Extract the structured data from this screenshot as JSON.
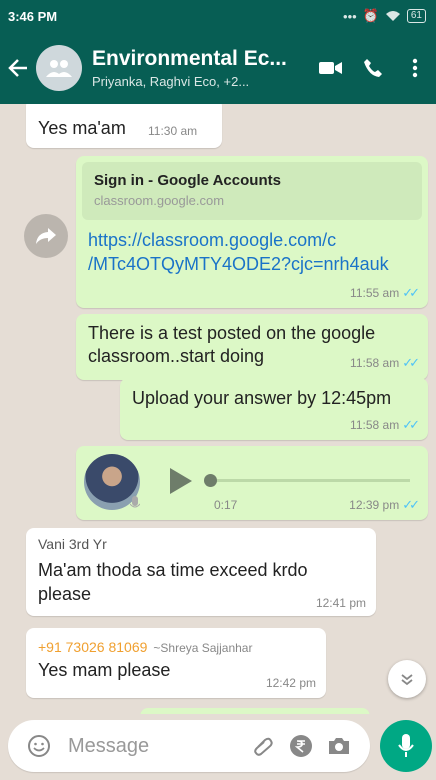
{
  "status": {
    "time": "3:46 PM",
    "battery": "61"
  },
  "header": {
    "title": "Environmental Ec...",
    "subtitle": "Priyanka, Raghvi Eco, +2..."
  },
  "messages": {
    "m1": {
      "text": "Yes ma'am",
      "time": "11:30 am"
    },
    "m2": {
      "preview_title": "Sign in - Google Accounts",
      "preview_domain": "classroom.google.com",
      "url_line1": "https://classroom.google.com/c",
      "url_line2": "/MTc4OTQyMTY4ODE2?cjc=nrh4auk",
      "time": "11:55 am"
    },
    "m3": {
      "line1": "There is a test posted on the google",
      "line2": "classroom..start doing",
      "time": "11:58 am"
    },
    "m4": {
      "text": "Upload your answer by 12:45pm",
      "time": "11:58 am"
    },
    "m5": {
      "duration": "0:17",
      "time": "12:39 pm"
    },
    "m6": {
      "sender": "Vani 3rd Yr",
      "line1": "Ma'am thoda sa time exceed krdo",
      "line2": "please",
      "time": "12:41 pm"
    },
    "m7": {
      "phone": "+91 73026 81069",
      "alias": "~Shreya Sajjanhar",
      "text": "Yes mam please",
      "time": "12:42 pm"
    }
  },
  "composer": {
    "placeholder": "Message"
  },
  "colors": {
    "header": "#075e54",
    "outgoing": "#dcf8c6",
    "incoming": "#ffffff",
    "link": "#1a73c8",
    "ticks": "#4fc3f7",
    "mic": "#00a884"
  },
  "icons": [
    "back-arrow-icon",
    "group-avatar-icon",
    "video-call-icon",
    "voice-call-icon",
    "more-options-icon",
    "forward-icon",
    "play-icon",
    "mic-icon",
    "scroll-down-icon",
    "emoji-icon",
    "attach-icon",
    "rupee-payment-icon",
    "camera-icon"
  ]
}
